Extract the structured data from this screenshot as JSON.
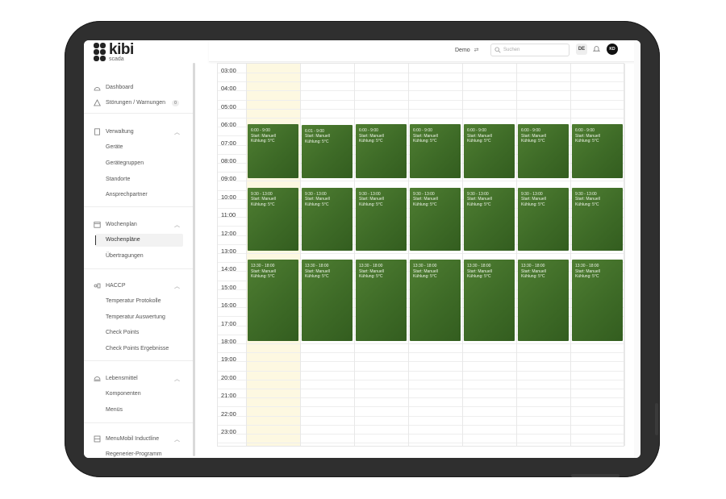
{
  "app": {
    "logo_text": "kibi",
    "logo_sub": "scada"
  },
  "sidebar": {
    "top_items": [
      {
        "label": "Dashboard",
        "icon": "dashboard-icon"
      },
      {
        "label": "Störungen / Warnungen",
        "icon": "warning-icon",
        "badge": "0"
      }
    ],
    "sections": [
      {
        "label": "Verwaltung",
        "icon": "device-icon",
        "items": [
          "Geräte",
          "Gerätegruppen",
          "Standorte",
          "Ansprechpartner"
        ]
      },
      {
        "label": "Wochenplan",
        "icon": "calendar-icon",
        "items": [
          "Wochenpläne",
          "Übertragungen"
        ],
        "active": "Wochenpläne"
      },
      {
        "label": "HACCP",
        "icon": "haccp-icon",
        "items": [
          "Temperatur Protokolle",
          "Temperatur Auswertung",
          "Check Points",
          "Check Points Ergebnisse"
        ]
      },
      {
        "label": "Lebensmittel",
        "icon": "food-icon",
        "items": [
          "Komponenten",
          "Menüs"
        ]
      },
      {
        "label": "MenuMobil Inductline",
        "icon": "menumobil-icon",
        "items": [
          "Regenerier-Programm"
        ]
      }
    ]
  },
  "topbar": {
    "demo_label": "Demo",
    "search_placeholder": "Suchen",
    "language": "DE",
    "avatar_initials": "KD"
  },
  "calendar": {
    "hours": [
      "03:00",
      "04:00",
      "05:00",
      "06:00",
      "07:00",
      "08:00",
      "09:00",
      "10:00",
      "11:00",
      "12:00",
      "13:00",
      "14:00",
      "15:00",
      "16:00",
      "17:00",
      "18:00",
      "19:00",
      "20:00",
      "21:00",
      "22:00",
      "23:00"
    ],
    "days": 7,
    "blocks": [
      {
        "times": [
          "6:00 - 9:00",
          "6:01 - 9:00",
          "6:00 - 9:00",
          "6:00 - 9:00",
          "6:00 - 9:00",
          "6:00 - 9:00",
          "6:00 - 9:00"
        ],
        "start": "Start: Manuell",
        "cooling": "Kühlung: 5°C"
      },
      {
        "times": [
          "9:30 - 13:00",
          "9:30 - 13:00",
          "9:30 - 13:00",
          "9:30 - 13:00",
          "9:30 - 13:00",
          "9:30 - 13:00",
          "9:30 - 13:00"
        ],
        "start": "Start: Manuell",
        "cooling": "Kühlung: 5°C"
      },
      {
        "times": [
          "13:30 - 18:00",
          "13:30 - 18:00",
          "13:30 - 18:00",
          "13:30 - 18:00",
          "13:30 - 18:00",
          "13:30 - 18:00",
          "13:30 - 18:00"
        ],
        "start": "Start: Manuell",
        "cooling": "Kühlung: 5°C"
      }
    ]
  },
  "colors": {
    "event_green": "#3e6b27",
    "today_highlight": "#fdf8e1",
    "tablet_frame": "#2f2f2f"
  }
}
